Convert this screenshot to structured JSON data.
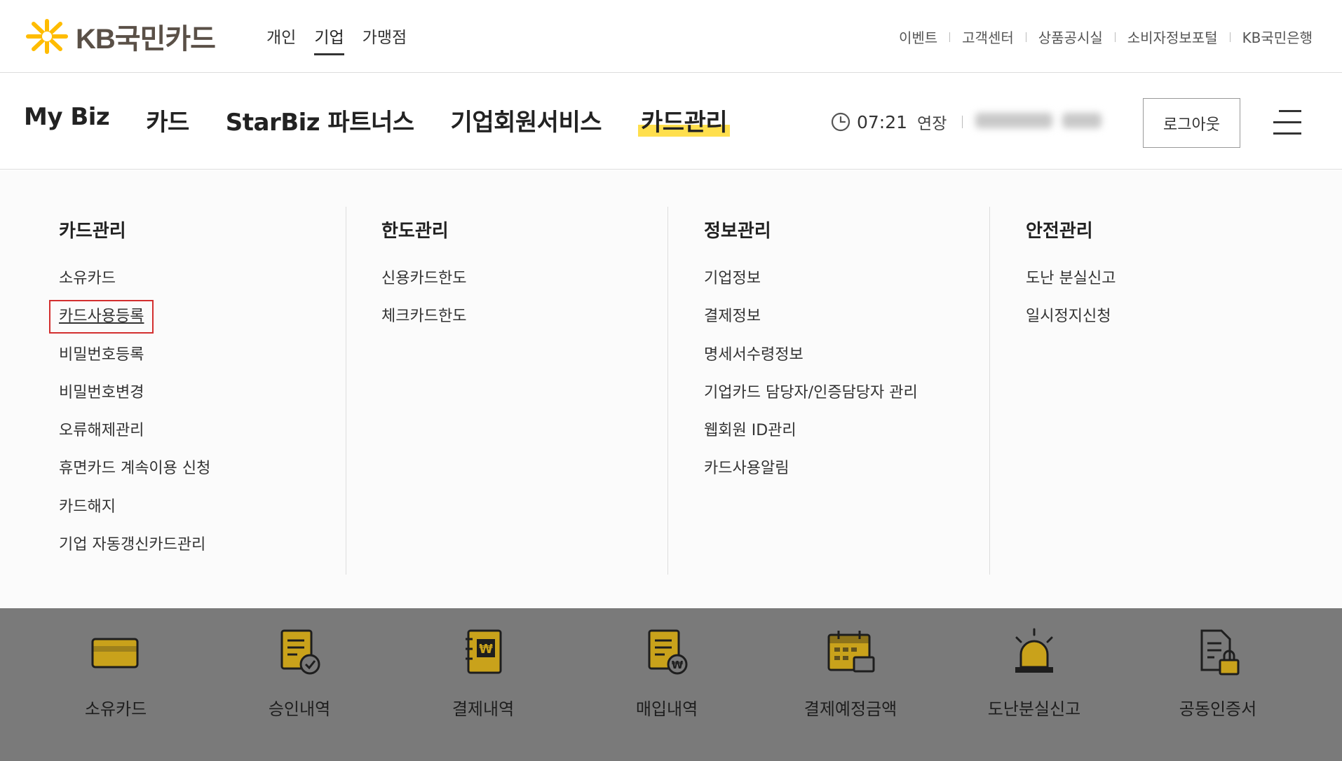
{
  "brand": {
    "logo_text": "KB국민카드",
    "accent": "#ffbc00",
    "text_color": "#5a5047"
  },
  "service_tabs": [
    {
      "label": "개인",
      "active": false
    },
    {
      "label": "기업",
      "active": true
    },
    {
      "label": "가맹점",
      "active": false
    }
  ],
  "util_links": [
    "이벤트",
    "고객센터",
    "상품공시실",
    "소비자정보포털",
    "KB국민은행"
  ],
  "gnb": [
    {
      "label": "My Biz",
      "active": false
    },
    {
      "label": "카드",
      "active": false
    },
    {
      "label": "StarBiz 파트너스",
      "active": false
    },
    {
      "label": "기업회원서비스",
      "active": false
    },
    {
      "label": "카드관리",
      "active": true
    }
  ],
  "session": {
    "time": "07:21",
    "extend_label": "연장"
  },
  "logout_label": "로그아웃",
  "mega_menu": [
    {
      "title": "카드관리",
      "items": [
        "소유카드",
        "카드사용등록",
        "비밀번호등록",
        "비밀번호변경",
        "오류해제관리",
        "휴면카드 계속이용 신청",
        "카드해지",
        "기업 자동갱신카드관리"
      ],
      "highlighted_index": 1
    },
    {
      "title": "한도관리",
      "items": [
        "신용카드한도",
        "체크카드한도"
      ]
    },
    {
      "title": "정보관리",
      "items": [
        "기업정보",
        "결제정보",
        "명세서수령정보",
        "기업카드 담당자/인증담당자 관리",
        "웹회원 ID관리",
        "카드사용알림"
      ]
    },
    {
      "title": "안전관리",
      "items": [
        "도난 분실신고",
        "일시정지신청"
      ]
    }
  ],
  "quick_menu": [
    {
      "label": "소유카드",
      "icon": "card-icon"
    },
    {
      "label": "승인내역",
      "icon": "approval-document-icon"
    },
    {
      "label": "결제내역",
      "icon": "payment-notebook-icon"
    },
    {
      "label": "매입내역",
      "icon": "purchase-document-icon"
    },
    {
      "label": "결제예정금액",
      "icon": "calendar-icon"
    },
    {
      "label": "도난분실신고",
      "icon": "siren-icon"
    },
    {
      "label": "공동인증서",
      "icon": "certificate-lock-icon"
    }
  ],
  "colors": {
    "highlight": "#ffdf4d",
    "focus_border": "#d32f2f",
    "quick_bg": "#7a7a7a",
    "icon_gold": "#c9a21b"
  }
}
